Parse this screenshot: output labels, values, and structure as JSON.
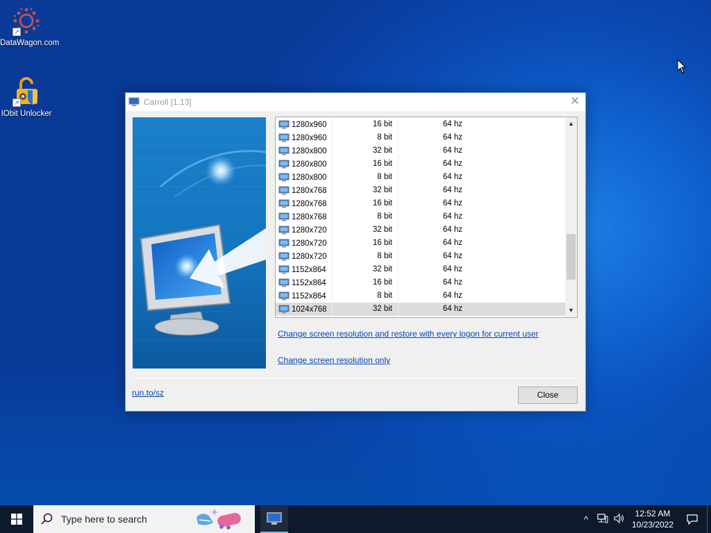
{
  "desktop": {
    "icons": [
      {
        "label": "DataWagon.com",
        "icon": "gear-dots-icon"
      },
      {
        "label": "IObit Unlocker",
        "icon": "unlock-shield-icon"
      }
    ]
  },
  "window": {
    "title": "Carroll [1.13]",
    "close_glyph": "✕",
    "list": {
      "rows": [
        {
          "res": "1280x960",
          "bits": "16 bit",
          "hz": "64 hz"
        },
        {
          "res": "1280x960",
          "bits": "8 bit",
          "hz": "64 hz"
        },
        {
          "res": "1280x800",
          "bits": "32 bit",
          "hz": "64 hz"
        },
        {
          "res": "1280x800",
          "bits": "16 bit",
          "hz": "64 hz"
        },
        {
          "res": "1280x800",
          "bits": "8 bit",
          "hz": "64 hz"
        },
        {
          "res": "1280x768",
          "bits": "32 bit",
          "hz": "64 hz"
        },
        {
          "res": "1280x768",
          "bits": "16 bit",
          "hz": "64 hz"
        },
        {
          "res": "1280x768",
          "bits": "8 bit",
          "hz": "64 hz"
        },
        {
          "res": "1280x720",
          "bits": "32 bit",
          "hz": "64 hz"
        },
        {
          "res": "1280x720",
          "bits": "16 bit",
          "hz": "64 hz"
        },
        {
          "res": "1280x720",
          "bits": "8 bit",
          "hz": "64 hz"
        },
        {
          "res": "1152x864",
          "bits": "32 bit",
          "hz": "64 hz"
        },
        {
          "res": "1152x864",
          "bits": "16 bit",
          "hz": "64 hz"
        },
        {
          "res": "1152x864",
          "bits": "8 bit",
          "hz": "64 hz"
        },
        {
          "res": "1024x768",
          "bits": "32 bit",
          "hz": "64 hz"
        }
      ],
      "selected_index": 14
    },
    "link_restore": "Change screen resolution and restore with every logon for current user",
    "link_only": "Change screen resolution only",
    "footer_link": "run.to/sz",
    "close_button": "Close"
  },
  "taskbar": {
    "search_placeholder": "Type here to search",
    "time": "12:52 AM",
    "date": "10/23/2022"
  }
}
